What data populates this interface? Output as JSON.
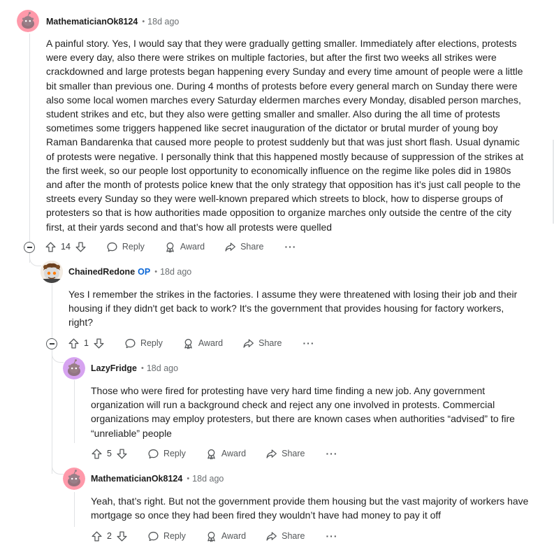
{
  "comments": [
    {
      "username": "MathematicianOk8124",
      "time": "18d ago",
      "body": "A painful story. Yes, I would say that they were gradually getting smaller. Immediately after elections, protests were every day, also there were strikes on multiple factories, but after the first two weeks all strikes were crackdowned and large protests began happening every Sunday and every time amount of people were a little bit smaller than previous one. During 4 months of protests before every general march on Sunday there were also some local women marches every Saturday eldermen marches every Monday, disabled person marches, student strikes and etc, but they also were getting smaller and smaller. Also during the all time of protests sometimes some triggers happened like secret inauguration of the dictator or brutal murder of young boy Raman Bandarenka that caused more people to protest suddenly but that was just short flash. Usual dynamic of protests were negative. I personally think that this happened mostly because of suppression of the strikes at the first week, so our people lost opportunity to economically influence on the regime like poles did in 1980s and after the month of protests police knew that the only strategy that opposition has it’s just call people to the streets every Sunday so they were well-known prepared which streets to block, how to disperse groups of protesters so that is how authorities made opposition to organize marches only outside the centre of the city first, at their yards second and that’s how all protests were quelled",
      "votes": "14"
    },
    {
      "username": "ChainedRedone",
      "op": "OP",
      "time": "18d ago",
      "body": "Yes I remember the strikes in the factories. I assume they were threatened with losing their job and their housing if they didn't get back to work? It's the government that provides housing for factory workers, right?",
      "votes": "1"
    },
    {
      "username": "LazyFridge",
      "time": "18d ago",
      "body": "Those who were fired for protesting have very hard time finding a new job. Any government organization will run a background check and reject any one involved in protests. Commercial organizations may employ protesters, but there are known cases when authorities “advised” to fire “unreliable” people",
      "votes": "5"
    },
    {
      "username": "MathematicianOk8124",
      "time": "18d ago",
      "body": "Yeah, that’s right. But not the government provide them housing but the vast majority of workers have mortgage so once they had been fired they wouldn’t have had money to pay it off",
      "votes": "2"
    }
  ],
  "actions": {
    "reply": "Reply",
    "award": "Award",
    "share": "Share",
    "more": "···"
  },
  "icons": [
    "upvote-icon",
    "downvote-icon",
    "reply-icon",
    "award-icon",
    "share-icon",
    "collapse-icon",
    "snoo-avatar"
  ],
  "colors": {
    "snoo_pink": "#ff99aa",
    "snoo_purple": "#d6a3f0",
    "op_blue": "#0a66d6",
    "thread_line": "#e0e2e4"
  }
}
